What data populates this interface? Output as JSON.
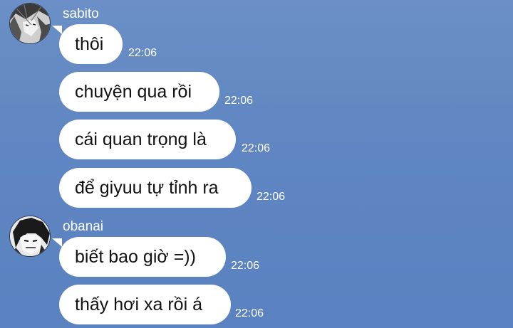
{
  "groups": [
    {
      "sender": "sabito",
      "avatar_icon": "manga-avatar-sabito",
      "messages": [
        {
          "text": "thôi",
          "time": "22:06"
        },
        {
          "text": "chuyện qua rồi",
          "time": "22:06"
        },
        {
          "text": "cái quan trọng là",
          "time": "22:06"
        },
        {
          "text": "để giyuu tự tỉnh ra",
          "time": "22:06"
        }
      ]
    },
    {
      "sender": "obanai",
      "avatar_icon": "manga-avatar-obanai",
      "messages": [
        {
          "text": "biết bao giờ =))",
          "time": "22:06"
        },
        {
          "text": "thấy hơi xa rồi á",
          "time": "22:06"
        }
      ]
    }
  ],
  "colors": {
    "background": "#5f86c2",
    "bubble": "#ffffff",
    "text": "#111111",
    "meta_text": "#ffffff"
  }
}
